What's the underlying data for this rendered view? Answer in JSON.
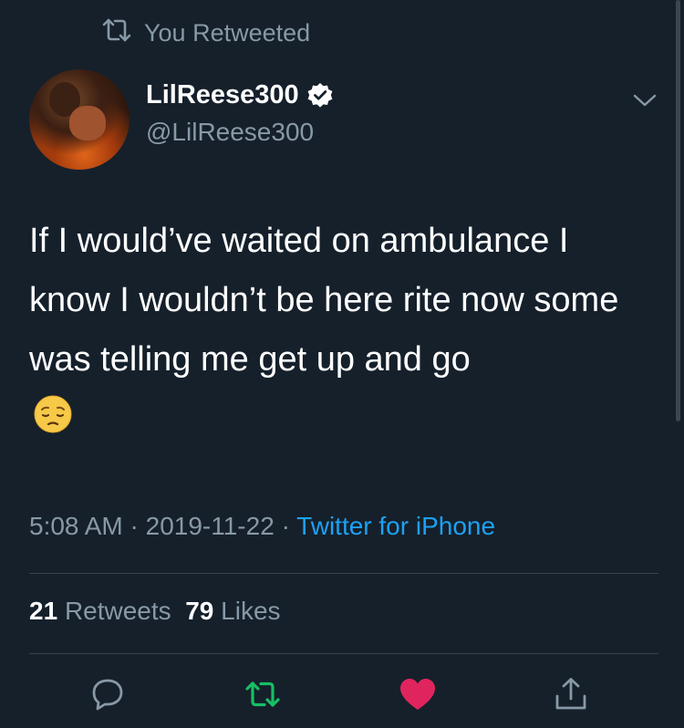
{
  "retweet_banner": {
    "text": "You Retweeted",
    "icon": "retweet-icon"
  },
  "author": {
    "display_name": "LilReese300",
    "handle": "@LilReese300",
    "verified": true,
    "verified_icon": "verified-badge-icon"
  },
  "tweet": {
    "text": "If I would’ve waited on ambulance I know I wouldn’t be here rite now some was telling me get up and go",
    "emoji": "pensive-face-emoji"
  },
  "meta": {
    "time": "5:08 AM",
    "separator": "·",
    "date": "2019-11-22",
    "source": "Twitter for iPhone"
  },
  "stats": {
    "retweets_count": "21",
    "retweets_label": "Retweets",
    "likes_count": "79",
    "likes_label": "Likes"
  },
  "actions": [
    {
      "icon": "reply-icon",
      "color": "#8899a6"
    },
    {
      "icon": "retweet-icon",
      "color": "#17bf63"
    },
    {
      "icon": "heart-icon",
      "color": "#e0245e"
    },
    {
      "icon": "share-icon",
      "color": "#8899a6"
    }
  ],
  "colors": {
    "background": "#15202b",
    "secondary_text": "#8899a6",
    "link": "#1da1f2",
    "retweet_green": "#17bf63",
    "like_red": "#e0245e"
  }
}
